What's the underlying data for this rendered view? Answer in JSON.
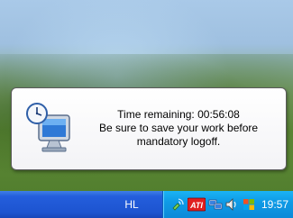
{
  "balloon": {
    "time_label": "Time remaining:",
    "time_value": "00:56:08",
    "line2": "Be sure to save your work before",
    "line3": "mandatory logoff."
  },
  "taskbar": {
    "language": "HL",
    "clock": "19:57",
    "tray_icons": [
      "satellite-icon",
      "ati-icon",
      "network-icon",
      "speaker-icon",
      "windows-update-icon"
    ]
  },
  "colors": {
    "taskbar_blue": "#245edc",
    "tray_blue": "#0f9be6"
  }
}
